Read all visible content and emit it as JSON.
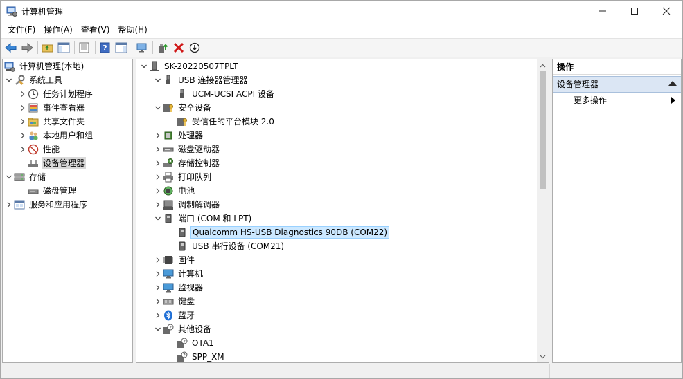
{
  "window": {
    "title": "计算机管理",
    "controls": [
      "minimize",
      "maximize",
      "close"
    ]
  },
  "menu": [
    "文件(F)",
    "操作(A)",
    "查看(V)",
    "帮助(H)"
  ],
  "toolbar": {
    "buttons": [
      "back-arrow-icon",
      "forward-arrow-icon",
      "up-folder-icon",
      "show-hide-tree-icon",
      "properties-icon",
      "help-icon",
      "show-hide-action-pane-icon",
      "monitor-icon",
      "update-driver-icon",
      "uninstall-icon",
      "disable-device-icon"
    ]
  },
  "left_tree": {
    "root": "计算机管理(本地)",
    "system_tools": "系统工具",
    "task_scheduler": "任务计划程序",
    "event_viewer": "事件查看器",
    "shared_folders": "共享文件夹",
    "local_users": "本地用户和组",
    "performance": "性能",
    "device_manager": "设备管理器",
    "storage": "存储",
    "disk_management": "磁盘管理",
    "services_apps": "服务和应用程序"
  },
  "device_tree": {
    "computer": "SK-20220507TPLT",
    "usb_controllers": "USB 连接器管理器",
    "ucm_ucsi": "UCM-UCSI ACPI 设备",
    "security_devices": "安全设备",
    "tpm": "受信任的平台模块 2.0",
    "processors": "处理器",
    "disk_drives": "磁盘驱动器",
    "storage_controllers": "存储控制器",
    "print_queues": "打印队列",
    "batteries": "电池",
    "modems": "调制解调器",
    "ports": "端口 (COM 和 LPT)",
    "qualcomm_port": "Qualcomm HS-USB Diagnostics 90DB (COM22)",
    "usb_serial": "USB 串行设备 (COM21)",
    "firmware": "固件",
    "computer_node": "计算机",
    "monitors": "监视器",
    "keyboards": "键盘",
    "bluetooth": "蓝牙",
    "other_devices": "其他设备",
    "ota1": "OTA1",
    "spp_xm": "SPP_XM"
  },
  "actions": {
    "header": "操作",
    "section": "设备管理器",
    "more_actions": "更多操作"
  }
}
